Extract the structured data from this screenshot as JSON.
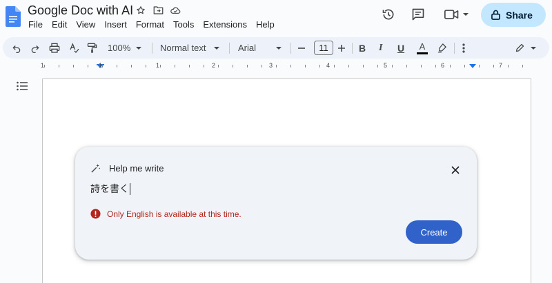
{
  "header": {
    "doc_title": "Google Doc with AI",
    "share_label": "Share",
    "menu": [
      "File",
      "Edit",
      "View",
      "Insert",
      "Format",
      "Tools",
      "Extensions",
      "Help"
    ]
  },
  "toolbar": {
    "zoom": "100%",
    "style": "Normal text",
    "font": "Arial",
    "font_size": "11",
    "bold": "B",
    "italic": "I",
    "underline": "U",
    "text_color": "A"
  },
  "ruler": {
    "numbers": [
      "1",
      "1",
      "1",
      "2",
      "3",
      "4",
      "5",
      "6",
      "7"
    ]
  },
  "help_me_write": {
    "title": "Help me write",
    "prompt": "詩を書く",
    "error": "Only English is available at this time.",
    "create_label": "Create"
  },
  "colors": {
    "accent": "#3162c9",
    "share_bg": "#c2e7ff",
    "error": "#b3261e",
    "card_bg": "#f0f4f9"
  },
  "icons": [
    "docs-logo-icon",
    "star-icon",
    "move-folder-icon",
    "cloud-status-icon",
    "history-icon",
    "comment-icon",
    "video-call-icon",
    "lock-icon",
    "undo-icon",
    "redo-icon",
    "print-icon",
    "spellcheck-icon",
    "paint-format-icon",
    "minus-icon",
    "plus-icon",
    "highlighter-icon",
    "more-vert-icon",
    "edit-pencil-icon",
    "outline-list-icon",
    "magic-pen-icon",
    "close-icon",
    "error-icon"
  ]
}
